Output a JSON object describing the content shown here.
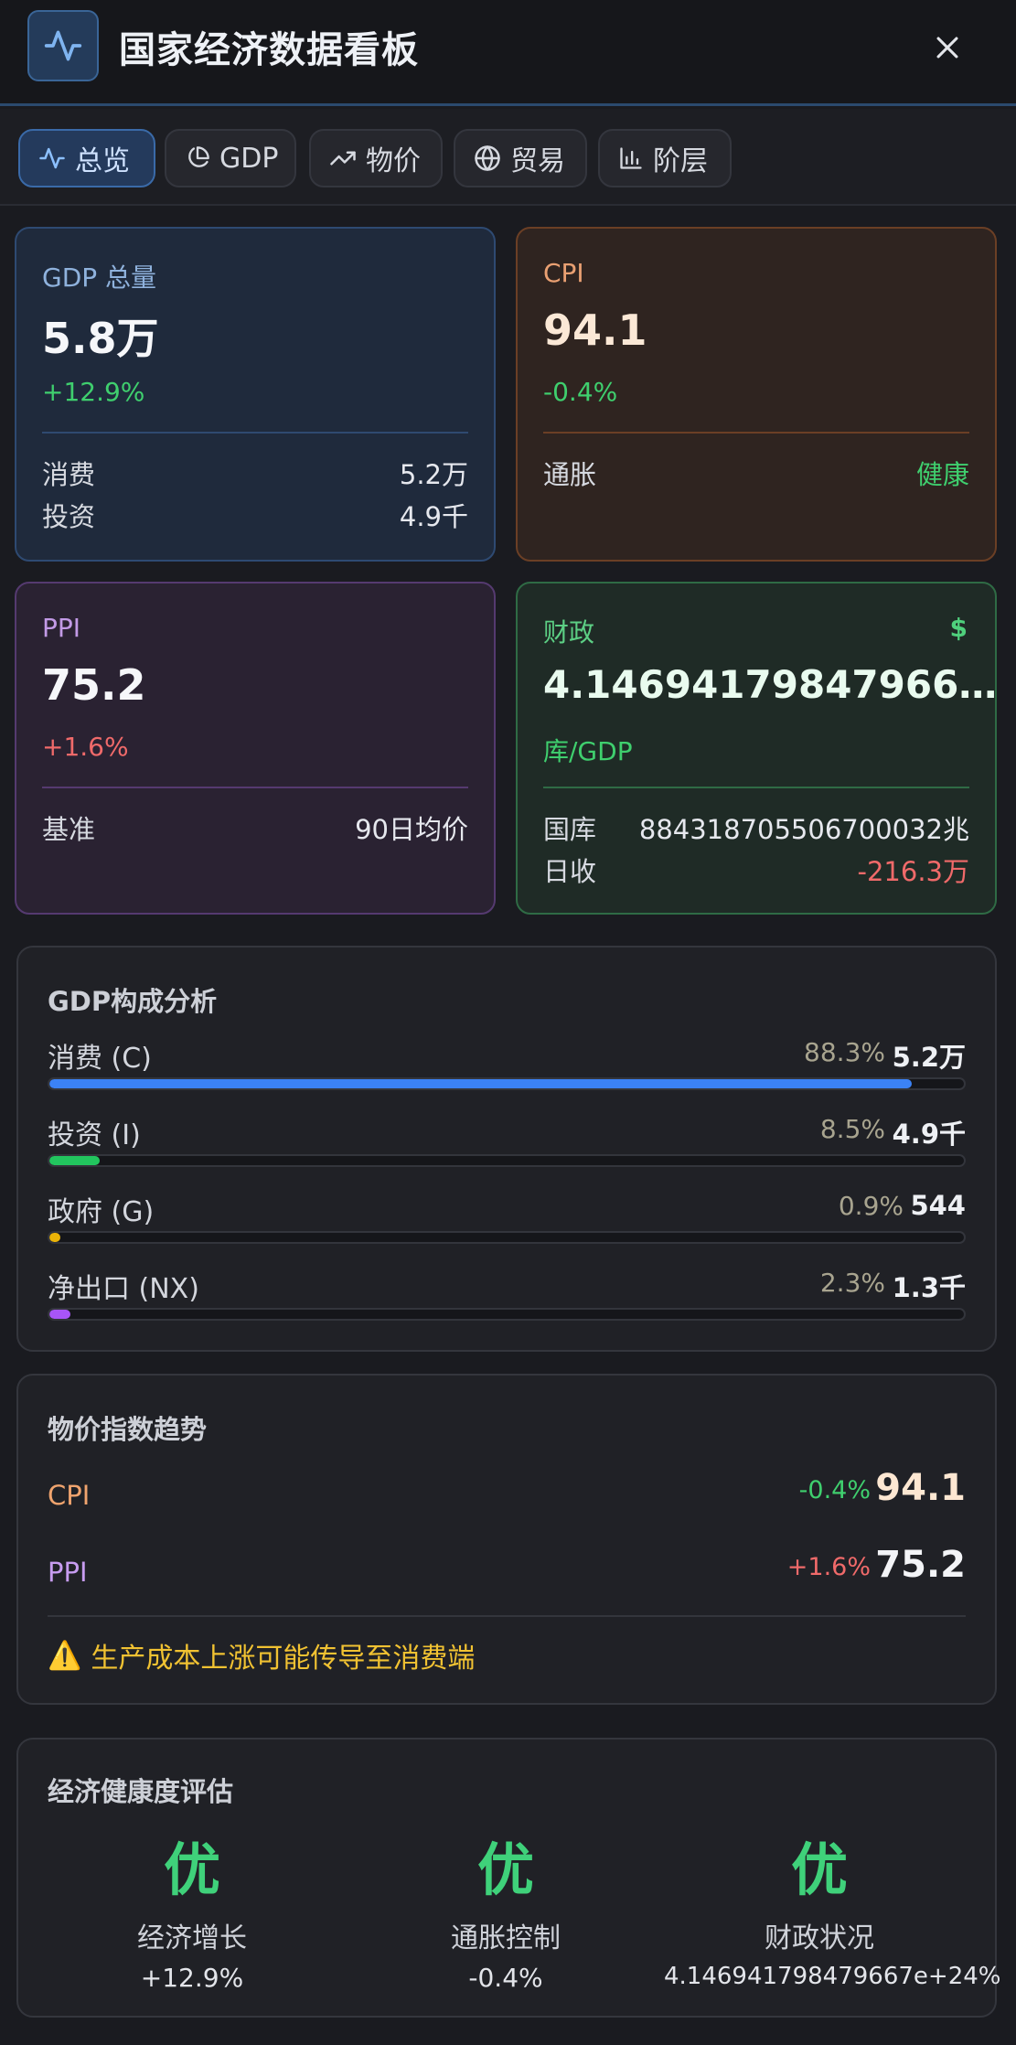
{
  "header": {
    "title": "国家经济数据看板"
  },
  "tabs": [
    {
      "label": "总览",
      "icon": "activity-icon"
    },
    {
      "label": "GDP",
      "icon": "pie-chart-icon"
    },
    {
      "label": "物价",
      "icon": "trending-up-icon"
    },
    {
      "label": "贸易",
      "icon": "globe-icon"
    },
    {
      "label": "阶层",
      "icon": "bar-chart-icon"
    }
  ],
  "cards": {
    "gdp": {
      "label": "GDP 总量",
      "value": "5.8万",
      "change": "+12.9%",
      "rows": [
        {
          "k": "消费",
          "v": "5.2万"
        },
        {
          "k": "投资",
          "v": "4.9千"
        }
      ]
    },
    "cpi": {
      "label": "CPI",
      "value": "94.1",
      "change": "-0.4%",
      "rows": [
        {
          "k": "通胀",
          "v": "健康"
        }
      ]
    },
    "ppi": {
      "label": "PPI",
      "value": "75.2",
      "change": "+1.6%",
      "rows": [
        {
          "k": "基准",
          "v": "90日均价"
        }
      ]
    },
    "fiscal": {
      "label": "财政",
      "icon_glyph": "$",
      "value": "4.14694179847966…",
      "sub": "库/GDP",
      "rows": [
        {
          "k": "国库",
          "v": "884318705506700032兆"
        },
        {
          "k": "日收",
          "v": "-216.3万"
        }
      ]
    }
  },
  "gdp_breakdown": {
    "title": "GDP构成分析",
    "items": [
      {
        "label": "消费 (C)",
        "pct": "88.3%",
        "value": "5.2万",
        "fill": 0.943,
        "color": "#3b82f6"
      },
      {
        "label": "投资 (I)",
        "pct": "8.5%",
        "value": "4.9千",
        "fill": 0.055,
        "color": "#22c55e"
      },
      {
        "label": "政府 (G)",
        "pct": "0.9%",
        "value": "544",
        "fill": 0.009,
        "color": "#eab308"
      },
      {
        "label": "净出口 (NX)",
        "pct": "2.3%",
        "value": "1.3千",
        "fill": 0.023,
        "color": "#a855f7"
      }
    ]
  },
  "price_trend": {
    "title": "物价指数趋势",
    "rows": [
      {
        "label": "CPI",
        "change": "-0.4%",
        "value": "94.1"
      },
      {
        "label": "PPI",
        "change": "+1.6%",
        "value": "75.2"
      }
    ],
    "warning": "生产成本上涨可能传导至消费端",
    "warning_icon": "⚠️"
  },
  "health": {
    "title": "经济健康度评估",
    "items": [
      {
        "grade": "优",
        "name": "经济增长",
        "value": "+12.9%"
      },
      {
        "grade": "优",
        "name": "通胀控制",
        "value": "-0.4%"
      },
      {
        "grade": "优",
        "name": "财政状况",
        "value": "4.146941798479667e+24%"
      }
    ]
  }
}
